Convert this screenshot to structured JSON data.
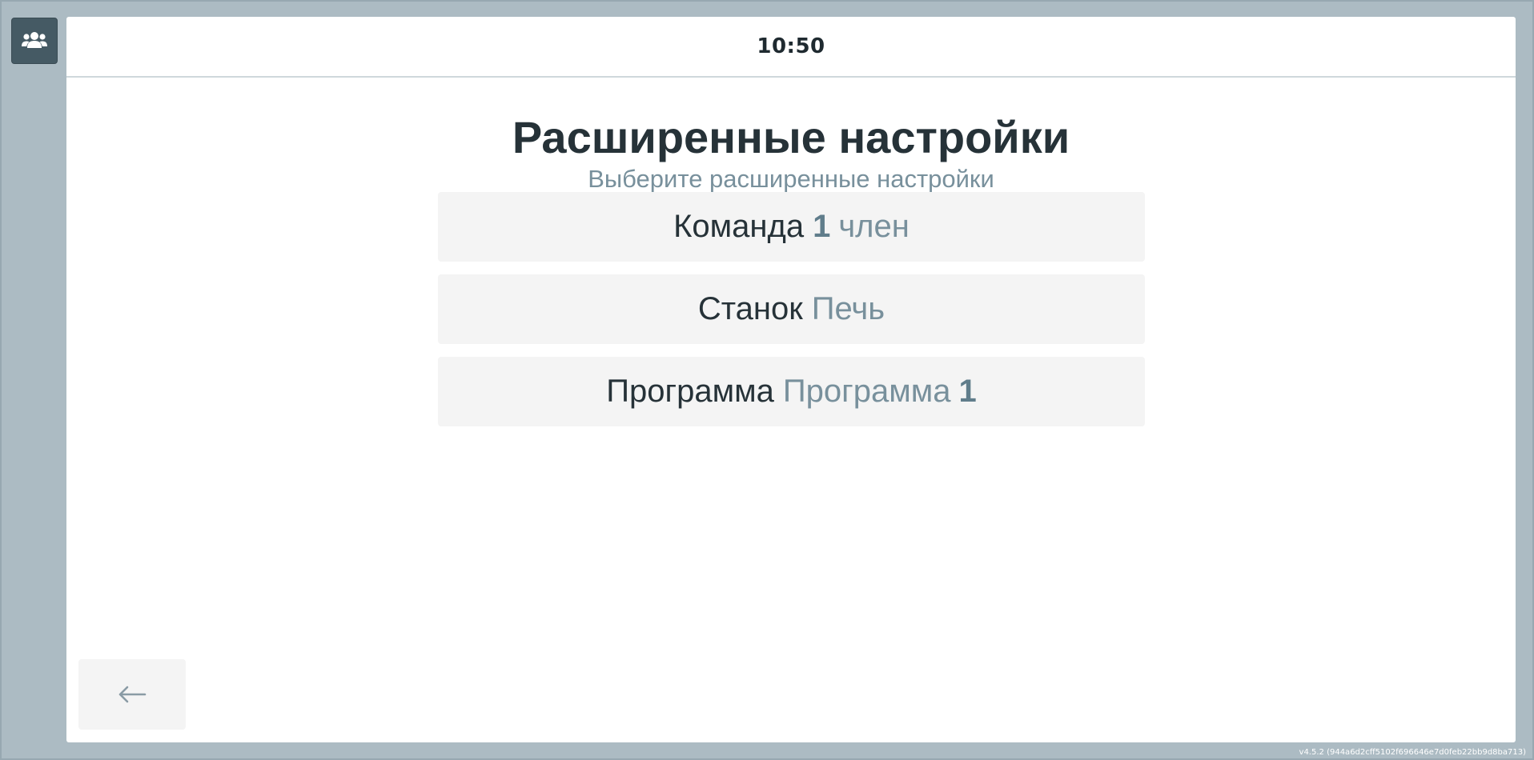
{
  "header": {
    "clock": "10:50"
  },
  "page": {
    "title": "Расширенные настройки",
    "subtitle": "Выберите расширенные настройки"
  },
  "options": [
    {
      "label": "Команда",
      "count": "1",
      "unit": "член"
    },
    {
      "label": "Станок",
      "value": "Печь"
    },
    {
      "label": "Программа",
      "value_text": "Программа",
      "value_num": "1"
    }
  ],
  "icons": {
    "team": "users-group-icon",
    "back": "arrow-left-icon"
  },
  "footer": {
    "version": "v4.5.2 (944a6d2cff5102f696646e7d0feb22bb9d8ba713)"
  },
  "colors": {
    "frame": "#acbbc3",
    "team_button": "#455a64",
    "title": "#263238",
    "muted": "#78909c",
    "option_bg": "#f4f4f4"
  }
}
